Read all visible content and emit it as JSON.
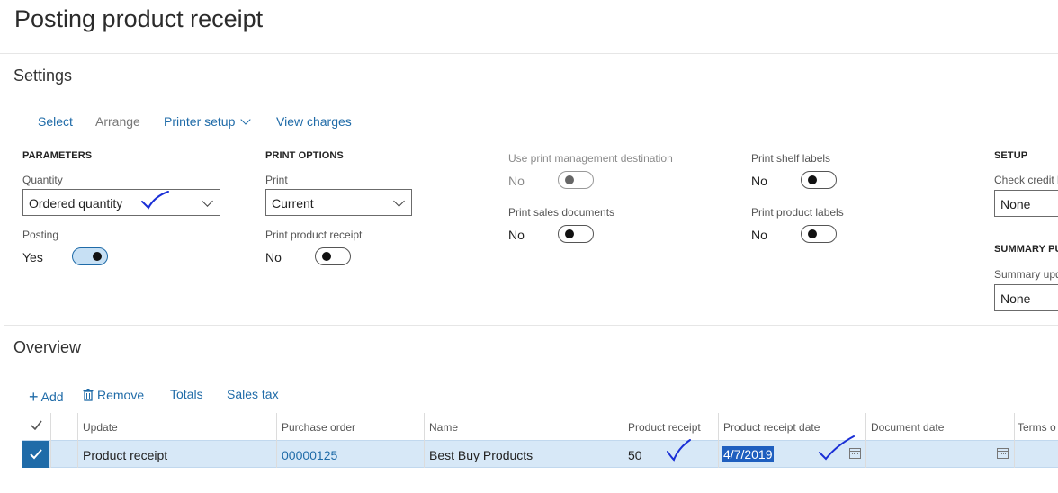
{
  "page": {
    "title": "Posting product receipt"
  },
  "settings": {
    "section_title": "Settings",
    "toolbar": {
      "select": "Select",
      "arrange": "Arrange",
      "printer_setup": "Printer setup",
      "view_charges": "View charges"
    },
    "parameters": {
      "heading": "PARAMETERS",
      "quantity_label": "Quantity",
      "quantity_value": "Ordered quantity",
      "posting_label": "Posting",
      "posting_value": "Yes"
    },
    "print_options": {
      "heading": "PRINT OPTIONS",
      "print_label": "Print",
      "print_value": "Current",
      "print_receipt_label": "Print product receipt",
      "print_receipt_value": "No"
    },
    "management": {
      "use_print_mgmt_label": "Use print management destination",
      "use_print_mgmt_value": "No",
      "print_sales_docs_label": "Print sales documents",
      "print_sales_docs_value": "No"
    },
    "labels": {
      "print_shelf_label": "Print shelf labels",
      "print_shelf_value": "No",
      "print_product_label": "Print product labels",
      "print_product_value": "No"
    },
    "setup": {
      "heading": "SETUP",
      "check_credit_label": "Check credit l",
      "check_credit_value": "None",
      "summary_heading": "SUMMARY PU",
      "summary_update_label": "Summary upd",
      "summary_update_value": "None"
    }
  },
  "overview": {
    "section_title": "Overview",
    "toolbar": {
      "add": "Add",
      "remove": "Remove",
      "totals": "Totals",
      "sales_tax": "Sales tax"
    },
    "columns": [
      "Update",
      "Purchase order",
      "Name",
      "Product receipt",
      "Product receipt date",
      "Document date",
      "Terms o"
    ],
    "rows": [
      {
        "update": "Product receipt",
        "purchase_order": "00000125",
        "name": "Best Buy Products",
        "product_receipt": "50",
        "product_receipt_date": "4/7/2019",
        "document_date": ""
      }
    ]
  },
  "colors": {
    "accent": "#1f6ba8",
    "selected_row": "#d7e8f7",
    "annotation": "#1a2fd6"
  }
}
